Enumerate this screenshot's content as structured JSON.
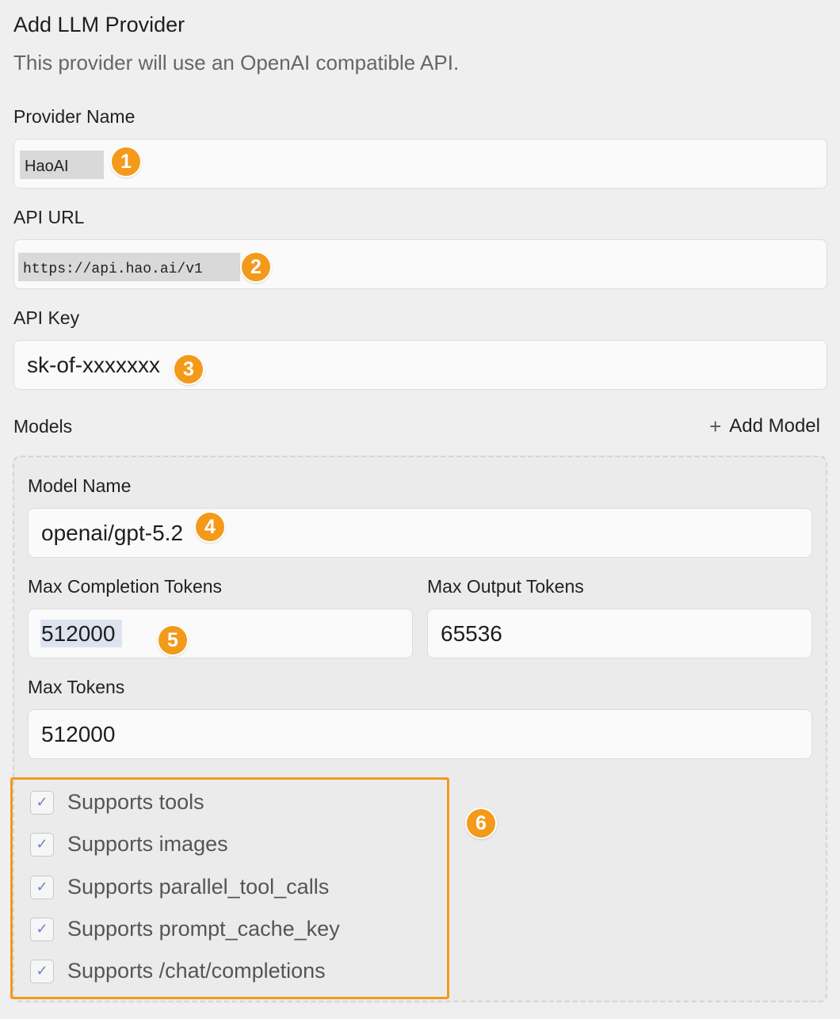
{
  "header": {
    "title": "Add LLM Provider",
    "subtitle": "This provider will use an OpenAI compatible API."
  },
  "provider_name": {
    "label": "Provider Name",
    "value": "HaoAI"
  },
  "api_url": {
    "label": "API URL",
    "value": "https://api.hao.ai/v1"
  },
  "api_key": {
    "label": "API Key",
    "value": "sk-of-xxxxxxx"
  },
  "models": {
    "label": "Models",
    "add_label": "Add Model",
    "model_name": {
      "label": "Model Name",
      "value": "openai/gpt-5.2"
    },
    "max_completion_tokens": {
      "label": "Max Completion Tokens",
      "value": "512000"
    },
    "max_output_tokens": {
      "label": "Max Output Tokens",
      "value": "65536"
    },
    "max_tokens": {
      "label": "Max Tokens",
      "value": "512000"
    },
    "supports": [
      {
        "label": "Supports tools",
        "checked": true
      },
      {
        "label": "Supports images",
        "checked": true
      },
      {
        "label": "Supports parallel_tool_calls",
        "checked": true
      },
      {
        "label": "Supports prompt_cache_key",
        "checked": true
      },
      {
        "label": "Supports /chat/completions",
        "checked": true
      }
    ]
  },
  "annotations": [
    "1",
    "2",
    "3",
    "4",
    "5",
    "6"
  ],
  "colors": {
    "badge": "#f39a1b",
    "check": "#6b7fc9"
  }
}
